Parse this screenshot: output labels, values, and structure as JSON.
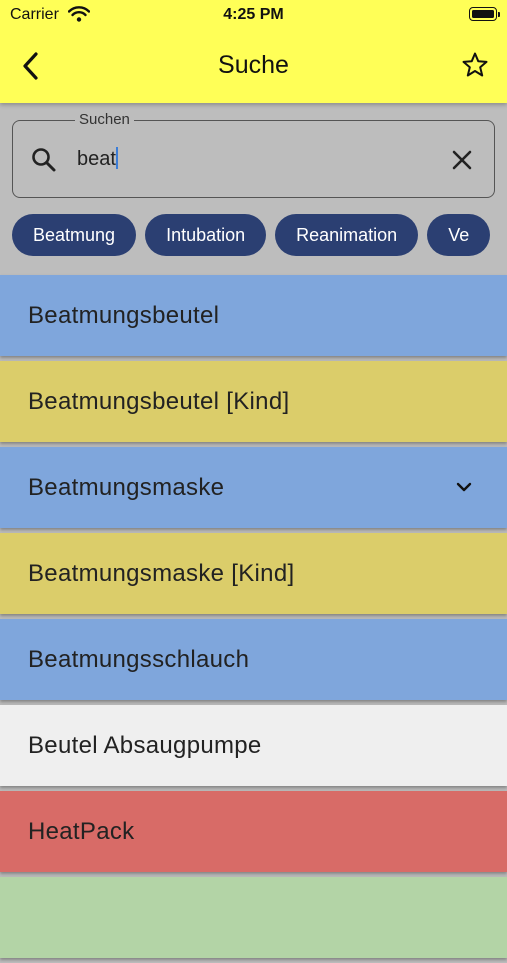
{
  "status_bar": {
    "carrier": "Carrier",
    "time": "4:25 PM"
  },
  "appbar": {
    "title": "Suche",
    "bg_color": "#ffff57"
  },
  "search": {
    "label": "Suchen",
    "value": "beat"
  },
  "chips": [
    {
      "label": "Beatmung"
    },
    {
      "label": "Intubation"
    },
    {
      "label": "Reanimation"
    },
    {
      "label": "Ve"
    }
  ],
  "results": [
    {
      "label": "Beatmungsbeutel",
      "color": "#7fa6dc",
      "expandable": false
    },
    {
      "label": "Beatmungsbeutel [Kind]",
      "color": "#dbcd6a",
      "expandable": false
    },
    {
      "label": "Beatmungsmaske",
      "color": "#7fa6dc",
      "expandable": true
    },
    {
      "label": "Beatmungsmaske [Kind]",
      "color": "#dbcd6a",
      "expandable": false
    },
    {
      "label": "Beatmungsschlauch",
      "color": "#7fa6dc",
      "expandable": false
    },
    {
      "label": "Beutel Absaugpumpe",
      "color": "#efefef",
      "expandable": false
    },
    {
      "label": "HeatPack",
      "color": "#d86b67",
      "expandable": false
    },
    {
      "label": "",
      "color": "#b3d4a6",
      "expandable": false
    }
  ]
}
